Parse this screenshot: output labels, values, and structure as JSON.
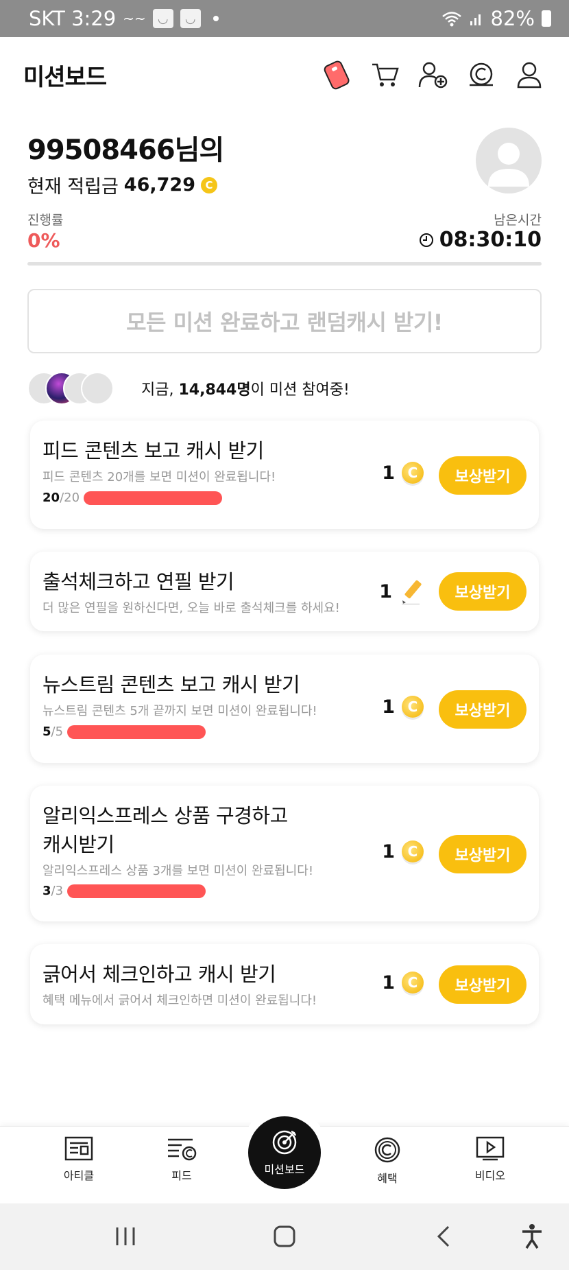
{
  "status_bar": {
    "carrier_time": "SKT 3:29",
    "battery": "82%"
  },
  "header": {
    "title": "미션보드"
  },
  "profile": {
    "name": "99508466님의",
    "balance_label": "현재 적립금",
    "balance_value": "46,729",
    "progress_label": "진행률",
    "progress_value": "0%",
    "progress_fraction": 0,
    "time_label": "남은시간",
    "time_value": "08:30:10"
  },
  "all_missions_button": "모든 미션 완료하고 랜덤캐시 받기!",
  "participants": {
    "prefix": "지금, ",
    "count": "14,844명",
    "suffix": "이 미션 참여중!"
  },
  "missions": [
    {
      "title": "피드 콘텐츠 보고 캐시 받기",
      "subtitle": "피드 콘텐츠 20개를 보면 미션이 완료됩니다!",
      "done": "20",
      "total": "/20",
      "reward": "1",
      "reward_icon": "coin-icon",
      "button": "보상받기"
    },
    {
      "title": "출석체크하고 연필 받기",
      "subtitle": "더 많은 연필을 원하신다면, 오늘 바로 출석체크를 하세요!",
      "reward": "1",
      "reward_icon": "pencil-icon",
      "button": "보상받기"
    },
    {
      "title": "뉴스트림 콘텐츠 보고 캐시 받기",
      "subtitle": "뉴스트림 콘텐츠 5개 끝까지 보면 미션이 완료됩니다!",
      "done": "5",
      "total": "/5",
      "reward": "1",
      "reward_icon": "coin-icon",
      "button": "보상받기"
    },
    {
      "title_line1": "알리익스프레스 상품 구경하고",
      "title_line2": "캐시받기",
      "subtitle": "알리익스프레스 상품 3개를 보면 미션이 완료됩니다!",
      "done": "3",
      "total": "/3",
      "reward": "1",
      "reward_icon": "coin-icon",
      "button": "보상받기"
    },
    {
      "title": "긁어서 체크인하고 캐시 받기",
      "subtitle": "혜택 메뉴에서 긁어서 체크인하면 미션이 완료됩니다!",
      "reward": "1",
      "reward_icon": "coin-icon",
      "button": "보상받기"
    }
  ],
  "bottom_nav": [
    {
      "label": "아티클",
      "icon": "article-icon"
    },
    {
      "label": "피드",
      "icon": "feed-icon"
    },
    {
      "label": "미션보드",
      "icon": "target-icon",
      "active": true
    },
    {
      "label": "혜택",
      "icon": "benefit-icon"
    },
    {
      "label": "비디오",
      "icon": "video-icon"
    }
  ],
  "colors": {
    "accent_yellow": "#f9bf0f",
    "progress_red": "#ff5555",
    "percent_red": "#ee5a5a"
  }
}
